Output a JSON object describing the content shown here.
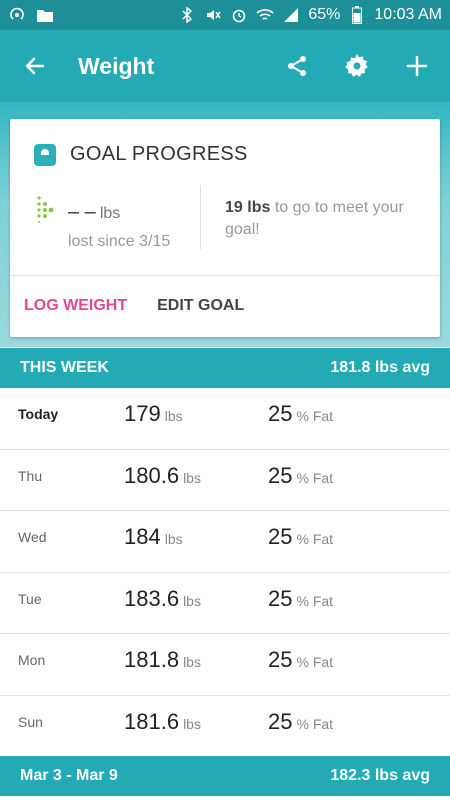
{
  "statusbar": {
    "battery": "65%",
    "time": "10:03 AM"
  },
  "appbar": {
    "title": "Weight"
  },
  "goal_card": {
    "title": "GOAL PROGRESS",
    "lost_value": "– –",
    "lost_unit": "lbs",
    "lost_since": "lost since 3/15",
    "remaining_value": "19 lbs",
    "remaining_text": "to go to meet your goal!",
    "log_weight_label": "LOG WEIGHT",
    "edit_goal_label": "EDIT GOAL"
  },
  "this_week": {
    "title": "THIS WEEK",
    "avg": "181.8 lbs avg",
    "rows": [
      {
        "day": "Today",
        "weight": "179",
        "weight_unit": "lbs",
        "fat": "25",
        "fat_unit": "% Fat"
      },
      {
        "day": "Thu",
        "weight": "180.6",
        "weight_unit": "lbs",
        "fat": "25",
        "fat_unit": "% Fat"
      },
      {
        "day": "Wed",
        "weight": "184",
        "weight_unit": "lbs",
        "fat": "25",
        "fat_unit": "% Fat"
      },
      {
        "day": "Tue",
        "weight": "183.6",
        "weight_unit": "lbs",
        "fat": "25",
        "fat_unit": "% Fat"
      },
      {
        "day": "Mon",
        "weight": "181.8",
        "weight_unit": "lbs",
        "fat": "25",
        "fat_unit": "% Fat"
      },
      {
        "day": "Sun",
        "weight": "181.6",
        "weight_unit": "lbs",
        "fat": "25",
        "fat_unit": "% Fat"
      }
    ]
  },
  "prev_week": {
    "title": "Mar 3 - Mar 9",
    "avg": "182.3 lbs avg"
  },
  "colors": {
    "accent": "#23aab5",
    "pink": "#e3488a"
  }
}
